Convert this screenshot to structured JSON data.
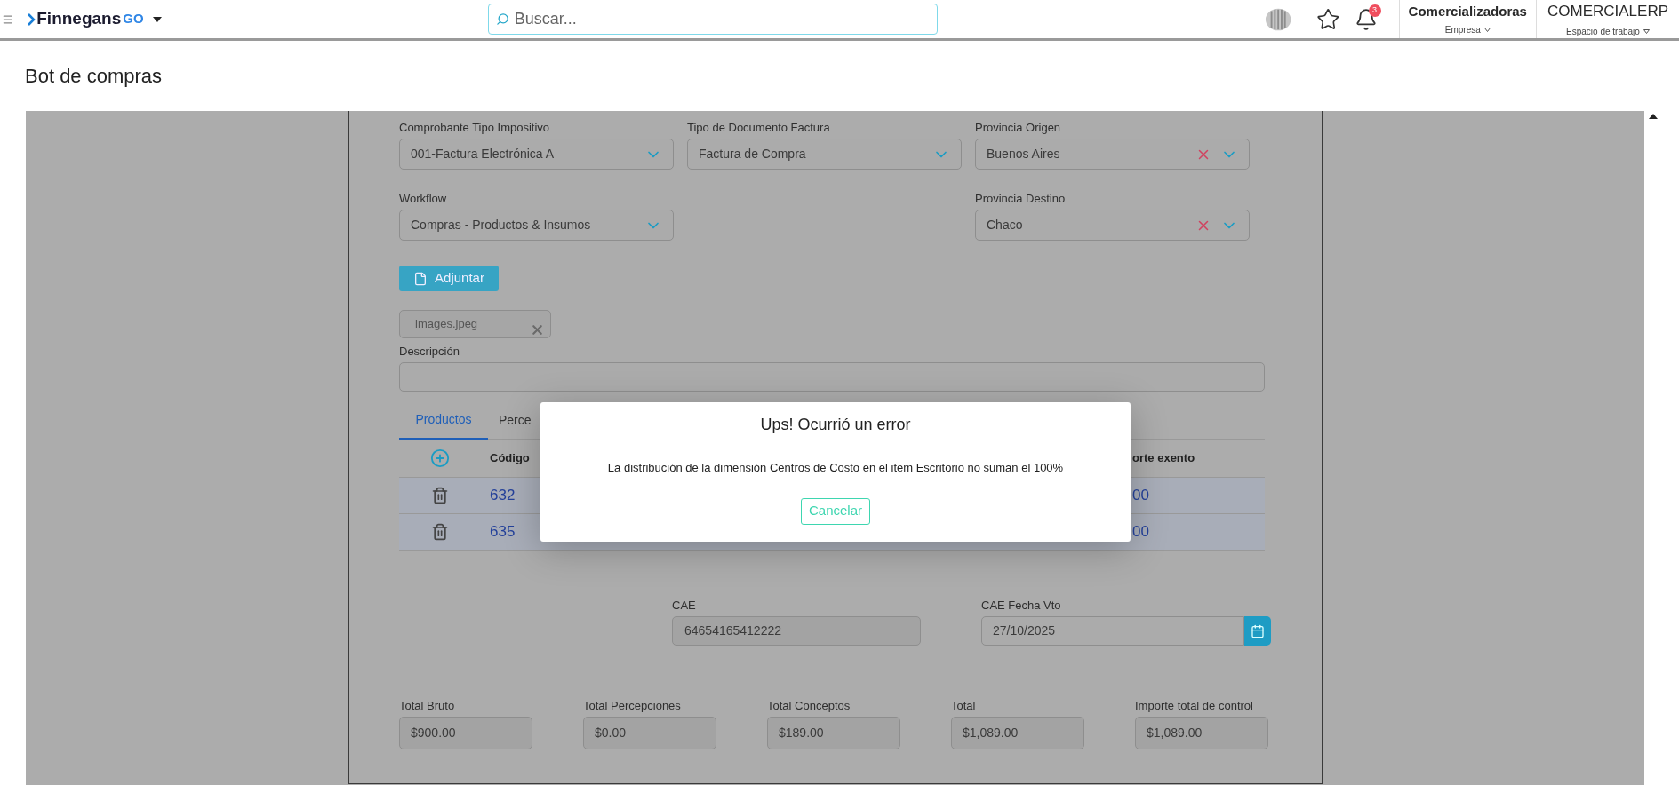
{
  "header": {
    "logo_text": "Finnegans",
    "logo_suffix": "GO",
    "search": {
      "placeholder": "Buscar..."
    },
    "notifications_badge": "3",
    "company": {
      "name": "Comercializadoras",
      "label": "Empresa"
    },
    "workspace": {
      "name": "COMERCIALERP",
      "label": "Espacio de trabajo"
    }
  },
  "page_title": "Bot de compras",
  "form": {
    "fields_row_1": [
      {
        "label": "Comprobante Tipo Impositivo",
        "value": "001-Factura Electrónica A",
        "clearable": false
      },
      {
        "label": "Tipo de Documento Factura",
        "value": "Factura de Compra",
        "clearable": false
      },
      {
        "label": "Provincia Origen",
        "value": "Buenos Aires",
        "clearable": true
      }
    ],
    "fields_row_2": [
      {
        "label": "Workflow",
        "value": "Compras - Productos & Insumos",
        "clearable": false
      },
      {
        "label": "Provincia Destino",
        "value": "Chaco",
        "clearable": true
      }
    ],
    "attach_button": "Adjuntar",
    "attachment": "images.jpeg",
    "description": {
      "label": "Descripción"
    },
    "tabs": [
      {
        "label": "Productos",
        "selected": true
      },
      {
        "label": "Perce",
        "selected": false
      }
    ],
    "table": {
      "columns": [
        "Código",
        "orte exento"
      ],
      "rows": [
        {
          "code": "632",
          "column_2": "00"
        },
        {
          "code": "635",
          "column_2": "00"
        }
      ]
    },
    "cae": {
      "label": "CAE",
      "value": "64654165412222"
    },
    "cae_due": {
      "label": "CAE Fecha Vto",
      "value": "27/10/2025"
    },
    "totals": [
      {
        "label": "Total Bruto",
        "value": "$900.00"
      },
      {
        "label": "Total Percepciones",
        "value": "$0.00"
      },
      {
        "label": "Total Conceptos",
        "value": "$189.00"
      },
      {
        "label": "Total",
        "value": "$1,089.00"
      },
      {
        "label": "Importe total de control",
        "value": "$1,089.00"
      }
    ]
  },
  "dialog": {
    "title": "Ups! Ocurrió un error",
    "message": "La distribución de la dimensión Centros de Costo en el item Escritorio no suman el 100%",
    "buttons": [
      "Cancelar"
    ]
  }
}
